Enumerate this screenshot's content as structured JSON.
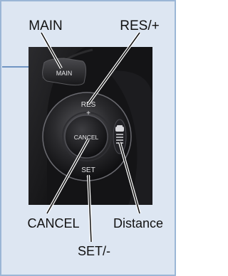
{
  "callouts": {
    "main": "MAIN",
    "res_plus": "RES/+",
    "cancel": "CANCEL",
    "distance": "Distance",
    "set_minus": "SET/-"
  },
  "buttons": {
    "main": "MAIN",
    "res_top": "RES",
    "res_bottom": "+",
    "cancel": "CANCEL",
    "set_top": "SET",
    "set_bottom": "−"
  },
  "icons": {
    "distance": "car-following-distance-icon"
  },
  "colors": {
    "panel": "#dde6f2",
    "border": "#9bb6d6",
    "accent": "#6f95c3",
    "photo_dark": "#141416"
  }
}
